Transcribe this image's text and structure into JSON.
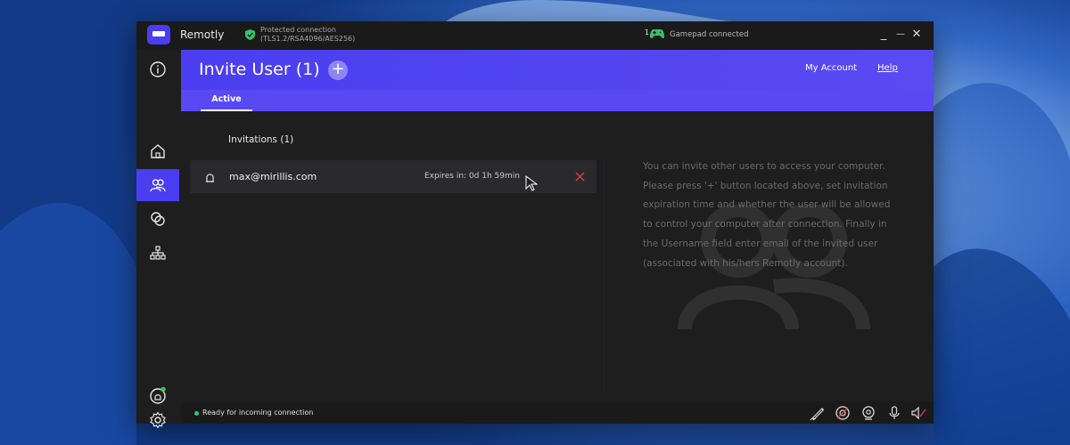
{
  "window": {
    "app_name": "Remotly",
    "connection_line1": "Protected connection",
    "connection_line2": "(TLS1.2/RSA4096/AES256)",
    "gamepad_count": "1",
    "gamepad_status": "Gamepad connected",
    "minimize_icon": "_",
    "maximize_icon": "—",
    "close_icon": "✕"
  },
  "header": {
    "title": "Invite User (1)",
    "add_label": "+",
    "my_account": "My Account",
    "help": "Help",
    "tabs": [
      {
        "label": "Active"
      }
    ]
  },
  "invitations": {
    "section_title": "Invitations (1)",
    "items": [
      {
        "email": "max@mirillis.com",
        "expires": "Expires in: 0d 1h 59min"
      }
    ]
  },
  "help_text": "You can invite other users to access your computer. Please press '+' button located above, set invitation expiration time and whether the user will be allowed to control your computer after connection. Finally in the Username field enter email of the invited user (associated with his/hers Remotly account).",
  "status": {
    "text": "Ready for incoming connection",
    "color": "#35c46a"
  },
  "sidebar": {
    "items": [
      "info-icon",
      "home-icon",
      "users-icon",
      "sessions-icon",
      "network-icon",
      "account-icon",
      "settings-icon"
    ]
  },
  "colors": {
    "accent": "#4a3ef0",
    "tab_bar": "#5849f3",
    "delete": "#e03a3a"
  }
}
